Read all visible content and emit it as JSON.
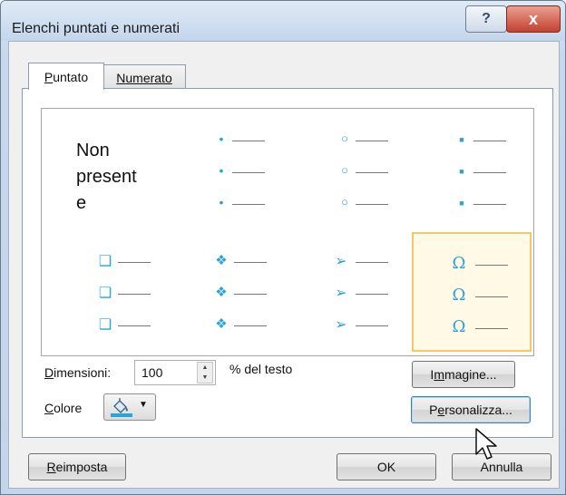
{
  "window": {
    "title": "Elenchi puntati e numerati",
    "help_symbol": "?",
    "close_symbol": "x"
  },
  "tabs": [
    {
      "label": "Puntato",
      "mnemonic": "P",
      "rest": "untato",
      "active": true
    },
    {
      "label": "Numerato",
      "mnemonic": "N",
      "rest": "umerato",
      "active": false
    }
  ],
  "gallery": {
    "none_label_lines": [
      "Non",
      "present",
      "e"
    ],
    "row1": [
      {
        "symbol": "•",
        "icon": "small-dot-bullet-icon"
      },
      {
        "symbol": "○",
        "icon": "hollow-circle-bullet-icon"
      },
      {
        "symbol": "■",
        "icon": "filled-square-bullet-icon"
      }
    ],
    "row2": [
      {
        "symbol": "❑",
        "icon": "shadowed-square-bullet-icon"
      },
      {
        "symbol": "❖",
        "icon": "four-diamond-bullet-icon"
      },
      {
        "symbol": "➢",
        "icon": "arrowhead-bullet-icon"
      },
      {
        "symbol": "Ω",
        "icon": "omega-bullet-icon"
      }
    ],
    "selected": "omega"
  },
  "size": {
    "label_mnemonic": "D",
    "label_rest": "imensioni:",
    "value": "100",
    "suffix": "% del testo"
  },
  "color": {
    "label_mnemonic": "C",
    "label_rest": "olore",
    "accent": "#29a4d8"
  },
  "buttons": {
    "image": {
      "pre": "I",
      "mnemonic": "m",
      "rest": "magine..."
    },
    "customize": {
      "pre": "P",
      "mnemonic": "e",
      "rest": "rsonalizza..."
    },
    "reset": {
      "mnemonic": "R",
      "rest": "eimposta"
    },
    "ok": "OK",
    "cancel": "Annulla"
  }
}
